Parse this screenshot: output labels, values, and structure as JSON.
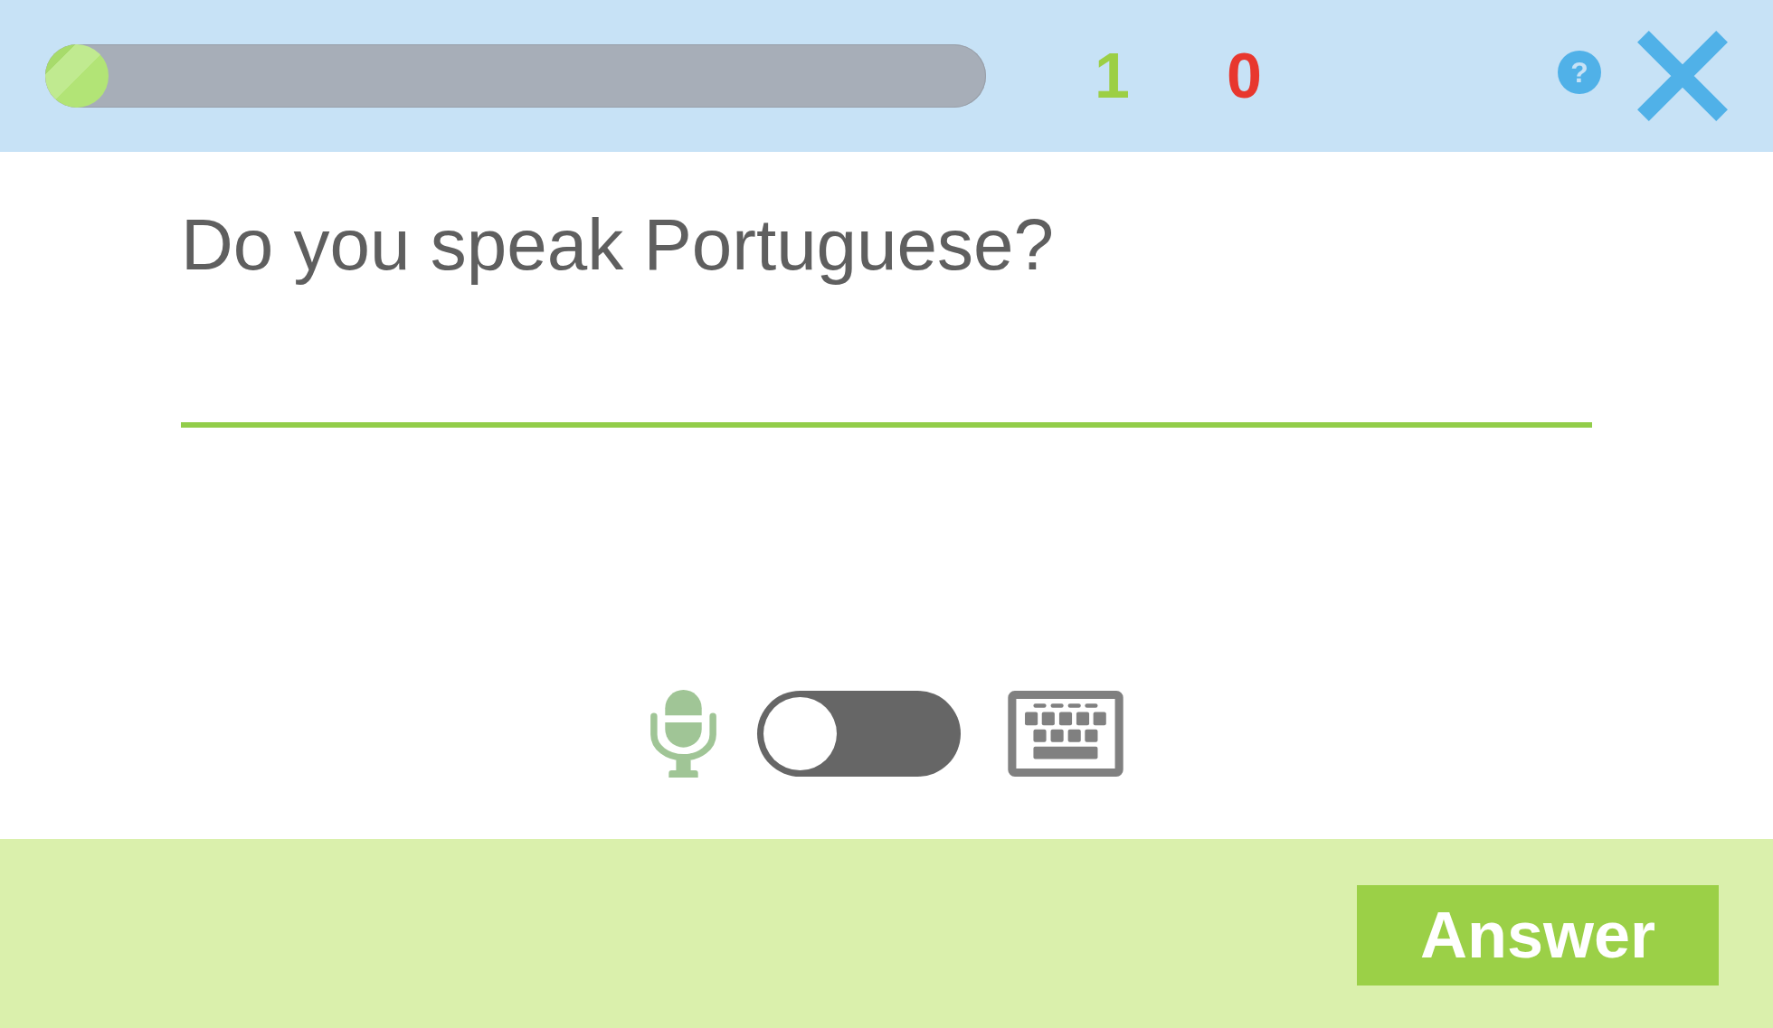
{
  "progress": {
    "level": 0
  },
  "scores": [
    {
      "kind": "correct",
      "value": "1"
    },
    {
      "kind": "wrong",
      "value": "0"
    }
  ],
  "help_button": {
    "label": "?"
  },
  "question": "Do you speak Portuguese?",
  "input_modes": [
    {
      "kind": "microphone",
      "selected": true
    },
    {
      "kind": "keyboard",
      "selected": false
    }
  ],
  "mode_switch": {
    "on": false
  },
  "submit_button": {
    "label": "Answer"
  }
}
